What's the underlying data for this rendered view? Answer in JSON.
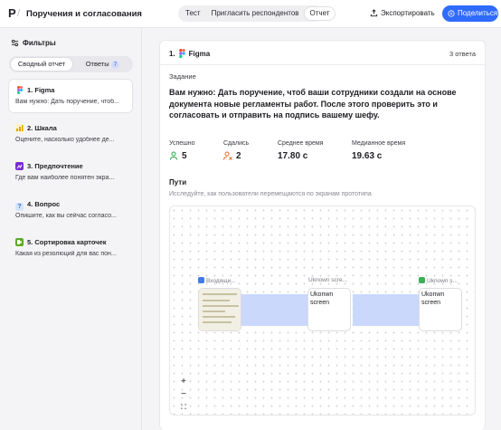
{
  "app": {
    "logo": "P",
    "breadcrumb_sep": "/",
    "title": "Поручения и согласования"
  },
  "header": {
    "tabs": [
      {
        "label": "Тест",
        "active": false
      },
      {
        "label": "Пригласить респондентов",
        "active": false
      },
      {
        "label": "Отчет",
        "active": true
      }
    ],
    "export_label": "Экспортировать",
    "share_label": "Поделиться"
  },
  "sidebar": {
    "filters_label": "Фильтры",
    "tabs": {
      "summary": "Сводный отчет",
      "answers": "Ответы",
      "answers_count": "7"
    },
    "questions": [
      {
        "num": "1.",
        "type": "Figma",
        "icon": "figma-icon",
        "color": "#ffffff",
        "desc": "Вам нужно: Дать поручение, чтоб...",
        "selected": true
      },
      {
        "num": "2.",
        "type": "Шкала",
        "icon": "bar-chart-icon",
        "color": "#f2b705",
        "desc": "Оцените, насколько удобнее де...",
        "selected": false
      },
      {
        "num": "3.",
        "type": "Предпочтение",
        "icon": "preference-icon",
        "color": "#7a2bd6",
        "desc": "Где вам наиболее понятен экра...",
        "selected": false
      },
      {
        "num": "4.",
        "type": "Вопрос",
        "icon": "question-icon",
        "color": "#3f87e8",
        "desc": "Опишите, как вы сейчас согласо...",
        "selected": false
      },
      {
        "num": "5.",
        "type": "Сортировка карточек",
        "icon": "card-sort-icon",
        "color": "#5aa82a",
        "desc": "Какая из резолюций для вас пон...",
        "selected": false
      }
    ]
  },
  "main": {
    "header": {
      "num": "1.",
      "type": "Figma",
      "count": "3 ответа"
    },
    "task_label": "Задание",
    "task_text": "Вам нужно: Дать поручение, чтоб ваши сотрудники создали на основе документа новые регламенты работ. После этого проверить это и согласовать и отправить на подпись вашему шефу.",
    "stats": [
      {
        "label": "Успешно",
        "value": "5",
        "icon": "user-success-icon",
        "color": "#27a844"
      },
      {
        "label": "Сдались",
        "value": "2",
        "icon": "user-giveup-icon",
        "color": "#ef6b2e"
      },
      {
        "label": "Среднее время",
        "value": "17.80 с",
        "icon": "",
        "color": ""
      },
      {
        "label": "Медианное время",
        "value": "19.63 с",
        "icon": "",
        "color": ""
      }
    ],
    "paths_label": "Пути",
    "paths_sub": "Исследуйте, как пользователи перемещаются по экранам прототипа",
    "flow": {
      "nodes": [
        {
          "label": "Входящи...",
          "icon": "start-icon",
          "color": "#3f7bea",
          "alt": ""
        },
        {
          "label": "Uknown scre...",
          "icon": "",
          "color": "",
          "alt": "Ukonwn screen"
        },
        {
          "label": "Uknown s...",
          "icon": "success-end-icon",
          "color": "#3cb054",
          "alt": "Ukonwn screen"
        }
      ]
    },
    "zoom": {
      "plus": "+",
      "minus": "−",
      "fit": "⛶"
    }
  }
}
